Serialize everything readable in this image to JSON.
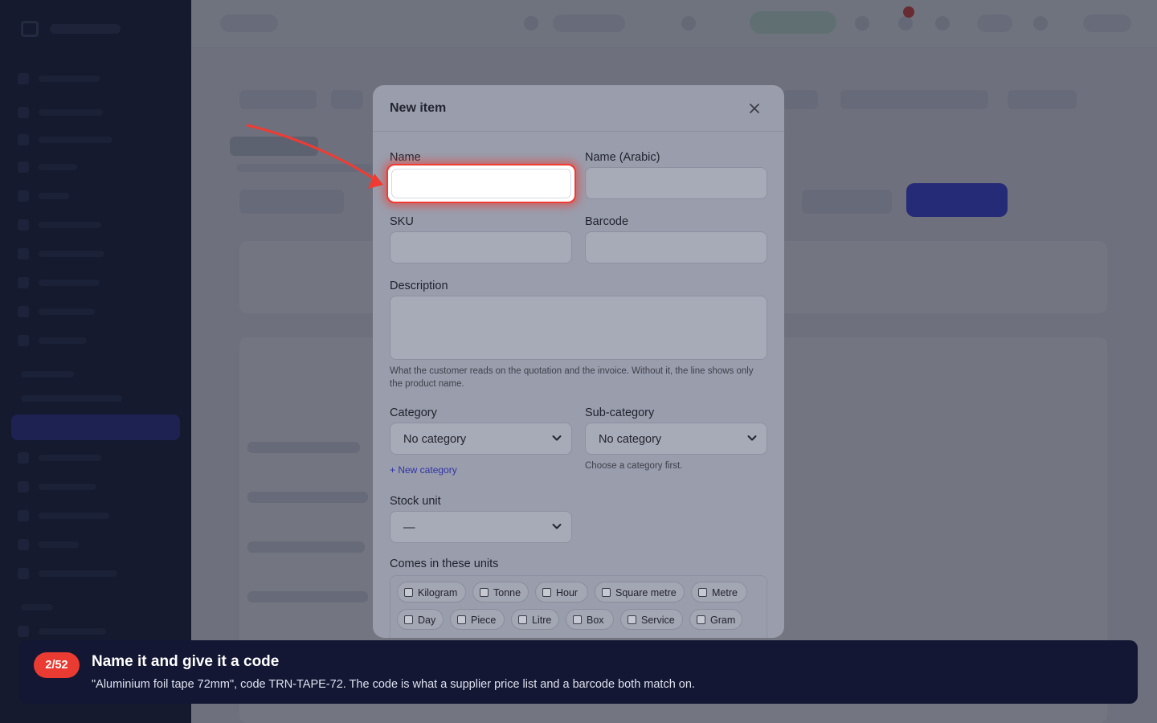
{
  "modal": {
    "title": "New item",
    "fields": {
      "name_label": "Name",
      "name_value": "",
      "name_arabic_label": "Name (Arabic)",
      "name_arabic_value": "",
      "sku_label": "SKU",
      "sku_value": "",
      "barcode_label": "Barcode",
      "barcode_value": "",
      "description_label": "Description",
      "description_value": "",
      "description_hint": "What the customer reads on the quotation and the invoice. Without it, the line shows only the product name.",
      "category_label": "Category",
      "category_value": "No category",
      "new_category_link": "+ New category",
      "subcategory_label": "Sub-category",
      "subcategory_value": "No category",
      "subcategory_hint": "Choose a category first.",
      "stock_unit_label": "Stock unit",
      "stock_unit_value": "—",
      "units_label": "Comes in these units"
    },
    "units": [
      "Kilogram",
      "Tonne",
      "Hour",
      "Square metre",
      "Metre",
      "Day",
      "Piece",
      "Litre",
      "Box",
      "Service",
      "Gram"
    ]
  },
  "tour": {
    "step": "2/52",
    "title": "Name it and give it a code",
    "body": "\"Aluminium foil tape 72mm\", code TRN-TAPE-72. The code is what a supplier price list and a barcode both match on."
  },
  "colors": {
    "accent": "#3d44e6",
    "highlight": "#ef3b33",
    "banner": "#131733",
    "sidebar": "#141933"
  },
  "icons": {
    "close": "close-icon",
    "chevron": "chevron-down-icon",
    "arrow": "pointer-arrow-icon"
  }
}
